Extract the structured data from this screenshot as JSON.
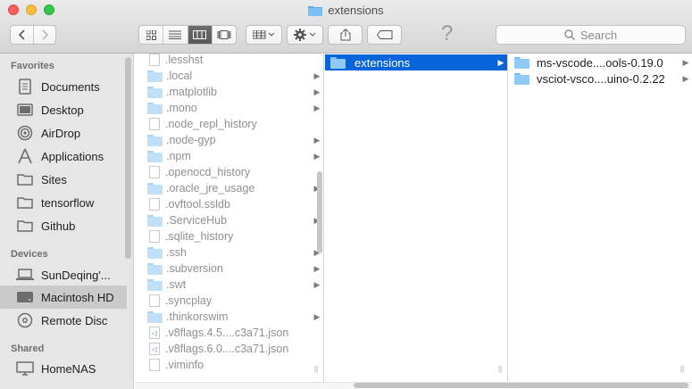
{
  "window": {
    "title": "extensions"
  },
  "toolbar": {
    "search_placeholder": "Search",
    "help_symbol": "?"
  },
  "sidebar": {
    "sections": [
      {
        "header": "Favorites",
        "items": [
          {
            "label": "Documents",
            "icon": "documents-icon"
          },
          {
            "label": "Desktop",
            "icon": "desktop-icon"
          },
          {
            "label": "AirDrop",
            "icon": "airdrop-icon"
          },
          {
            "label": "Applications",
            "icon": "applications-icon"
          },
          {
            "label": "Sites",
            "icon": "folder-icon"
          },
          {
            "label": "tensorflow",
            "icon": "folder-icon"
          },
          {
            "label": "Github",
            "icon": "folder-icon"
          }
        ]
      },
      {
        "header": "Devices",
        "items": [
          {
            "label": "SunDeqing'...",
            "icon": "laptop-icon"
          },
          {
            "label": "Macintosh HD",
            "icon": "harddisk-icon",
            "selected": true
          },
          {
            "label": "Remote Disc",
            "icon": "disc-icon"
          }
        ]
      },
      {
        "header": "Shared",
        "items": [
          {
            "label": "HomeNAS",
            "icon": "display-icon"
          }
        ]
      }
    ]
  },
  "columns": {
    "col1": [
      {
        "name": ".lesshst",
        "kind": "file"
      },
      {
        "name": ".local",
        "kind": "folder"
      },
      {
        "name": ".matplotlib",
        "kind": "folder"
      },
      {
        "name": ".mono",
        "kind": "folder"
      },
      {
        "name": ".node_repl_history",
        "kind": "file"
      },
      {
        "name": ".node-gyp",
        "kind": "folder"
      },
      {
        "name": ".npm",
        "kind": "folder"
      },
      {
        "name": ".openocd_history",
        "kind": "file"
      },
      {
        "name": ".oracle_jre_usage",
        "kind": "folder"
      },
      {
        "name": ".ovftool.ssldb",
        "kind": "file"
      },
      {
        "name": ".ServiceHub",
        "kind": "folder"
      },
      {
        "name": ".sqlite_history",
        "kind": "file"
      },
      {
        "name": ".ssh",
        "kind": "folder"
      },
      {
        "name": ".subversion",
        "kind": "folder"
      },
      {
        "name": ".swt",
        "kind": "folder"
      },
      {
        "name": ".syncplay",
        "kind": "file"
      },
      {
        "name": ".thinkorswim",
        "kind": "folder"
      },
      {
        "name": ".v8flags.4.5....c3a71.json",
        "kind": "vs"
      },
      {
        "name": ".v8flags.6.0....c3a71.json",
        "kind": "vs"
      },
      {
        "name": ".viminfo",
        "kind": "file"
      }
    ],
    "col2": [
      {
        "name": "extensions",
        "kind": "folder",
        "selected": true
      }
    ],
    "col3": [
      {
        "name": "ms-vscode....ools-0.19.0",
        "kind": "folder"
      },
      {
        "name": "vsciot-vsco....uino-0.2.22",
        "kind": "folder"
      }
    ]
  },
  "colors": {
    "selection": "#0865d9",
    "folder": "#8fcaf6"
  }
}
